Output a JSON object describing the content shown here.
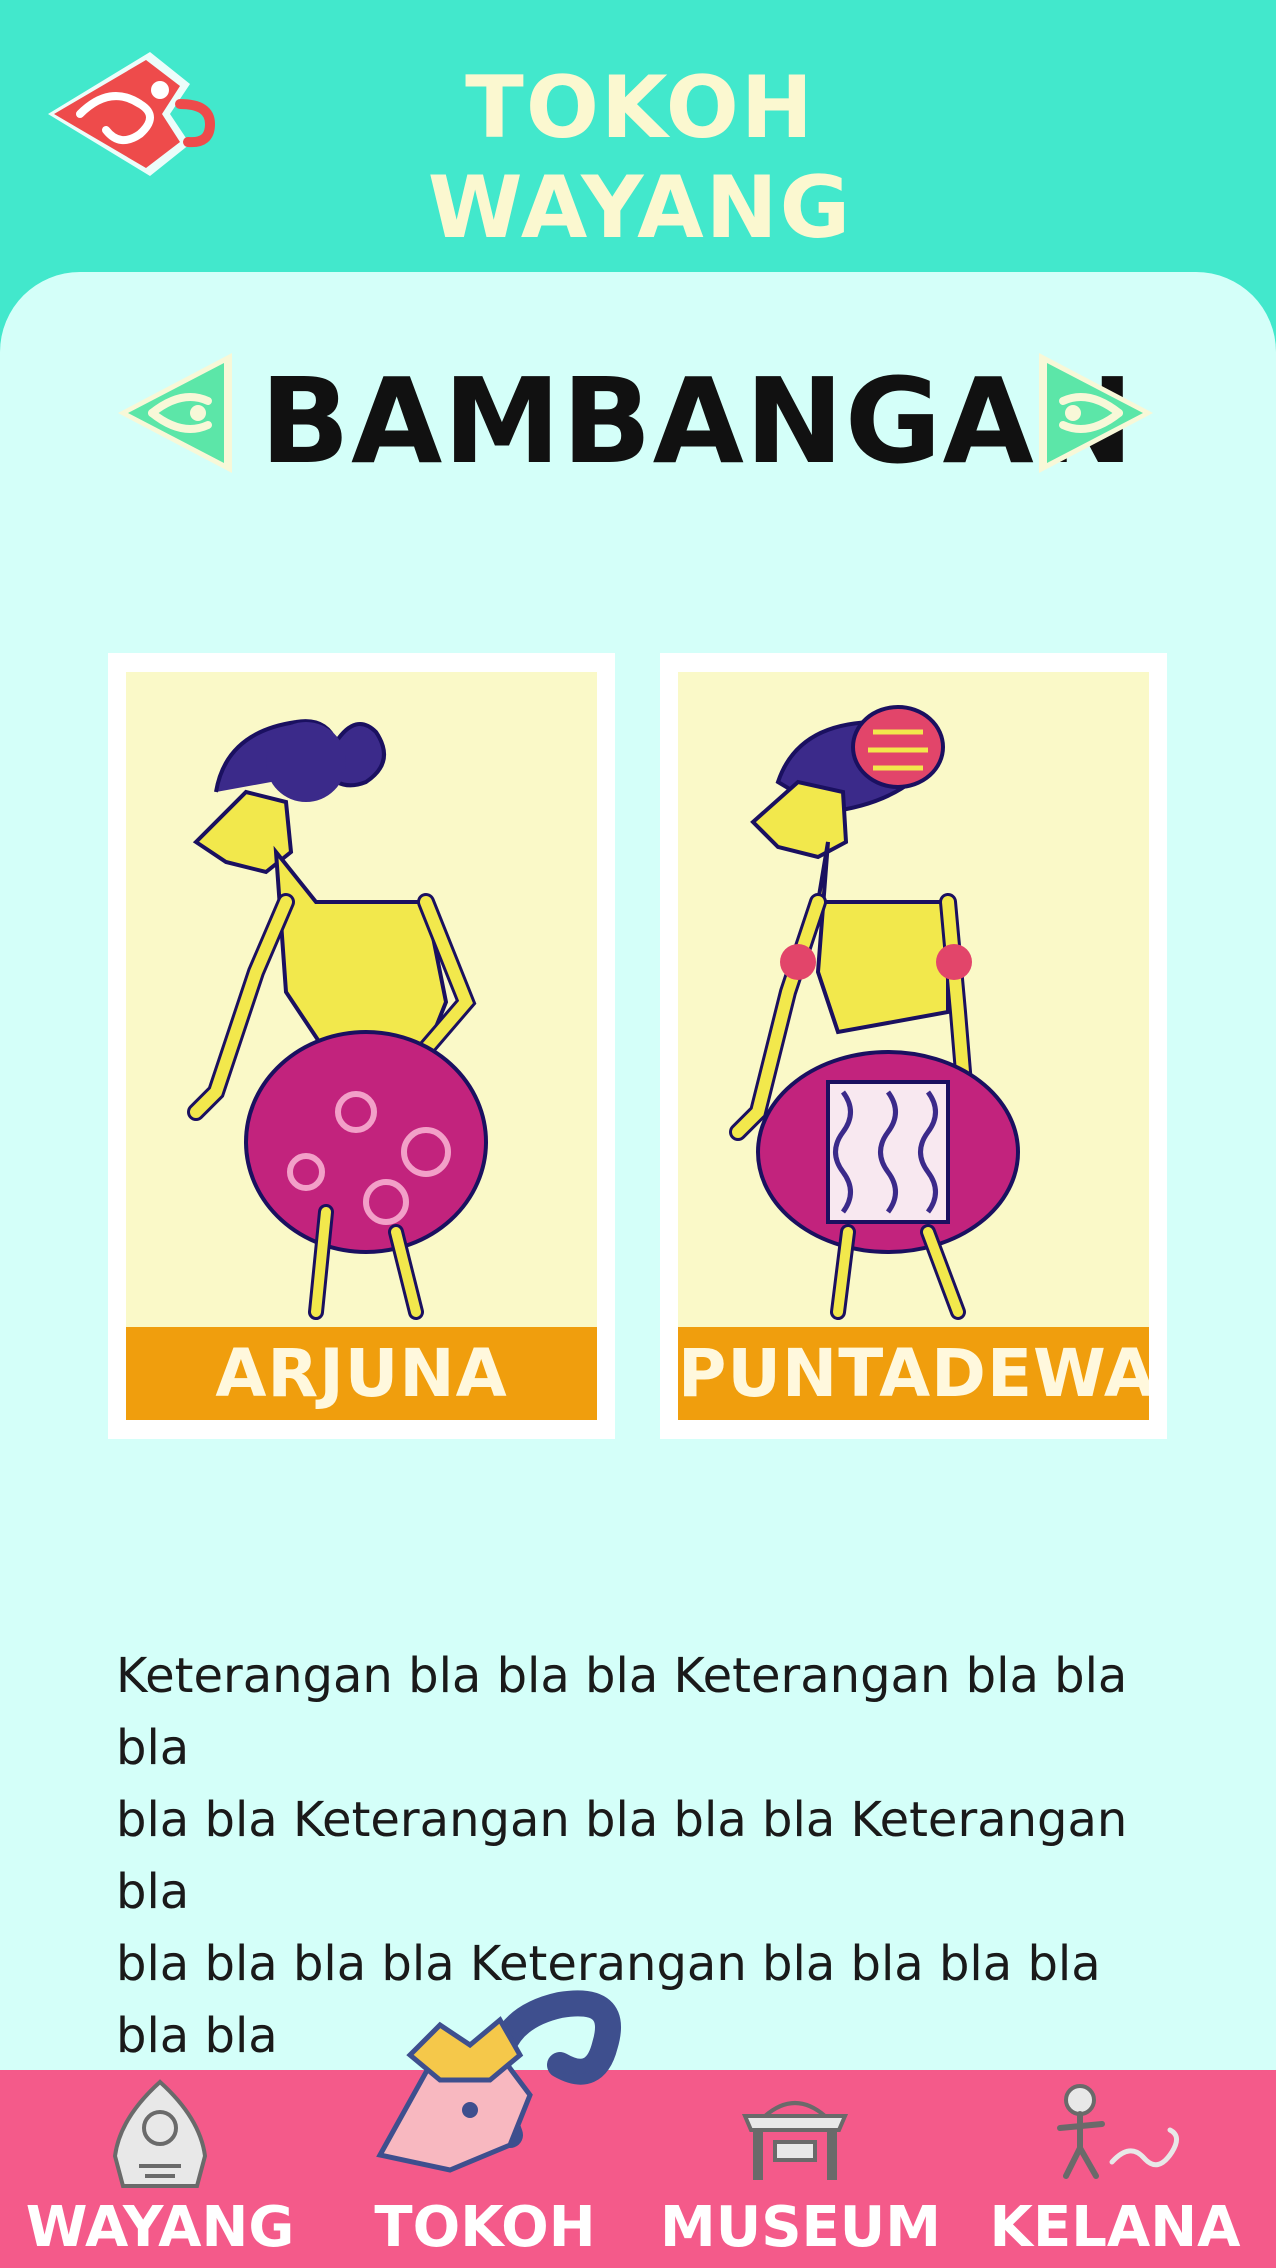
{
  "header": {
    "title": "TOKOH WAYANG",
    "back_icon": "ornament-back-icon"
  },
  "category": {
    "title": "BAMBANGAN",
    "prev_icon": "ornament-left-arrow-icon",
    "next_icon": "ornament-right-arrow-icon"
  },
  "characters": [
    {
      "name": "ARJUNA",
      "image": "wayang-arjuna-figure"
    },
    {
      "name": "PUNTADEWA",
      "image": "wayang-puntadewa-figure"
    }
  ],
  "description": {
    "line1": "Keterangan bla bla bla Keterangan bla bla bla",
    "line2": "bla bla  Keterangan bla bla bla Keterangan bla",
    "line3": "bla bla bla bla Keterangan bla bla bla bla bla bla"
  },
  "bottom_nav": {
    "items": [
      {
        "label": "WAYANG",
        "icon": "gunungan-icon"
      },
      {
        "label": "TOKOH",
        "icon": "wayang-head-icon",
        "active": true
      },
      {
        "label": "MUSEUM",
        "icon": "gamelan-icon"
      },
      {
        "label": "KELANA",
        "icon": "explorer-icon"
      }
    ]
  },
  "colors": {
    "header_bg": "#42E8CC",
    "panel_bg": "#D4FFF9",
    "label_bg": "#F09E0D",
    "bottom_bar": "#F45A8A",
    "ornament_red": "#EE4B4B",
    "ornament_green": "#5CE6A8"
  }
}
